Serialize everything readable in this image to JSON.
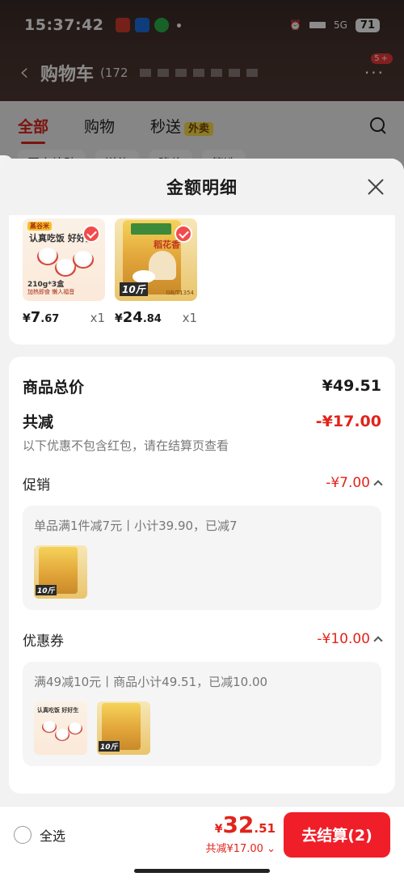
{
  "status_bar": {
    "time": "15:37:42",
    "network": "5G",
    "battery": "71"
  },
  "nav": {
    "title": "购物车",
    "count": "(172",
    "badge": "5+"
  },
  "tabs": [
    {
      "label": "全部"
    },
    {
      "label": "购物"
    },
    {
      "label": "秒送",
      "tag": "外卖"
    }
  ],
  "chips": [
    "国家补贴",
    "送礼",
    "降价",
    "筛选"
  ],
  "sheet": {
    "title": "金额明细",
    "products": [
      {
        "yen": "¥",
        "price_int": "7",
        "price_dec": ".67",
        "qty": "x1",
        "bowl_brand": "蒸谷米",
        "bowl_slogan": "认真吃饭 好好生",
        "bowl_weight": "210g*3盒",
        "bowl_foot": "加热即食 懒人福音"
      },
      {
        "yen": "¥",
        "price_int": "24",
        "price_dec": ".84",
        "qty": "x1",
        "bag_title": "稻花香",
        "bag_weight": "10斤",
        "bag_foot": "GB/T1354"
      }
    ],
    "summary": {
      "total_label": "商品总价",
      "total_value": "¥49.51",
      "reduce_label": "共减",
      "reduce_value": "-¥17.00",
      "note": "以下优惠不包含红包，请在结算页查看",
      "promo_label": "促销",
      "promo_value": "-¥7.00",
      "promo_detail": "单品满1件减7元丨小计39.90，已减7",
      "coupon_label": "优惠券",
      "coupon_value": "-¥10.00",
      "coupon_detail": "满49减10元丨商品小计49.51，已减10.00"
    }
  },
  "checkout": {
    "select_all": "全选",
    "yen": "¥",
    "price_int": "32",
    "price_dec": ".51",
    "reduce": "共减¥17.00",
    "button": "去结算(2)"
  },
  "colors": {
    "accent": "#e2231a",
    "button": "#f01e28"
  }
}
